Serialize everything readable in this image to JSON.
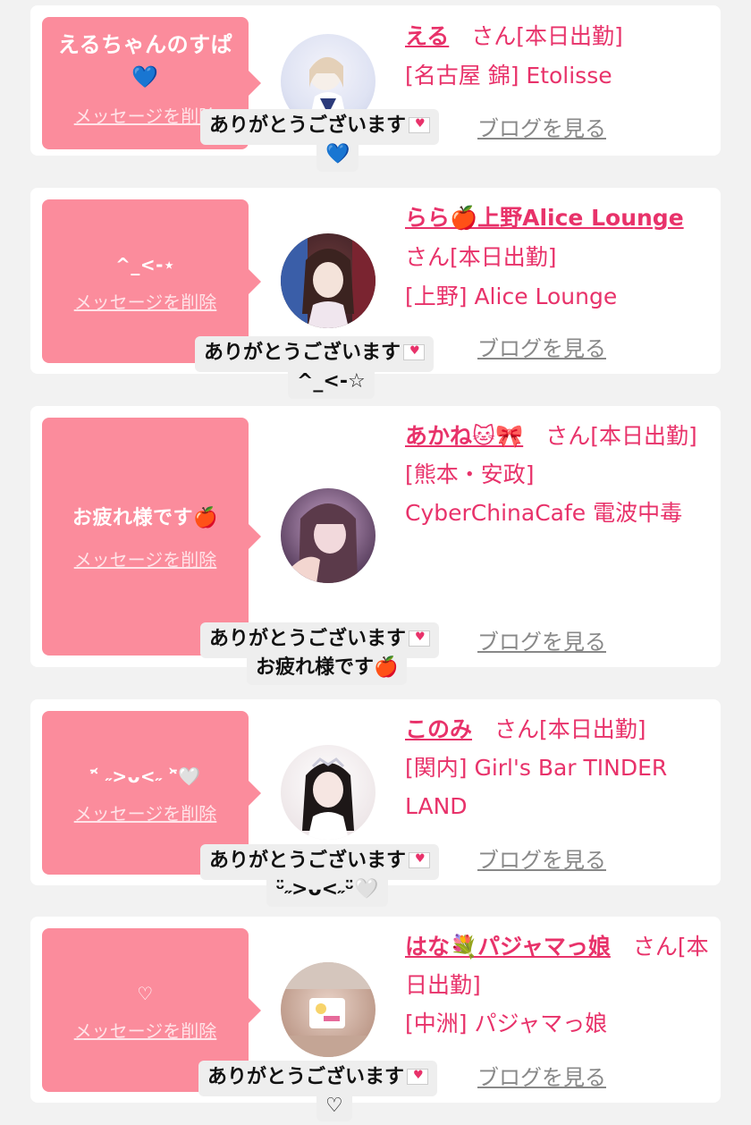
{
  "colors": {
    "accent": "#e8326a",
    "message_box": "#fb8c9c",
    "bubble": "#eeeeee",
    "background": "#f2f2f2"
  },
  "cards": [
    {
      "message": "えるちゃんのすぱ💙",
      "delete_label": "メッセージを削除",
      "name": "える",
      "san_label": "さん",
      "status": "[本日出勤]",
      "location": "[名古屋 錦] Etolisse",
      "blog_label": "ブログを見る",
      "bubble_line1": "ありがとうございます",
      "bubble_line2": "💙",
      "avatar_icon": "avatar-photo"
    },
    {
      "message": "^_<-⋆",
      "delete_label": "メッセージを削除",
      "name": "らら🍎上野Alice Lounge",
      "san_label": "さん",
      "status": "[本日出勤]",
      "location": "[上野] Alice Lounge",
      "blog_label": "ブログを見る",
      "bubble_line1": "ありがとうございます",
      "bubble_line2": "^_<-☆",
      "avatar_icon": "avatar-photo"
    },
    {
      "message": "お疲れ様です🍎",
      "delete_label": "メッセージを削除",
      "name": "あかね🐱🎀",
      "san_label": "さん",
      "status": "[本日出勤]",
      "location": "[熊本・安政] CyberChinaCafe 電波中毒",
      "blog_label": "ブログを見る",
      "bubble_line1": "ありがとうございます",
      "bubble_line2": "お疲れ様です🍎",
      "avatar_icon": "avatar-photo"
    },
    {
      "message": "ᵔ᷄ ˶>ᴗ<˶ ᵔ᷅🤍",
      "delete_label": "メッセージを削除",
      "name": "このみ",
      "san_label": "さん",
      "status": "[本日出勤]",
      "location": "[関内] Girl's Bar TINDER LAND",
      "blog_label": "ブログを見る",
      "bubble_line1": "ありがとうございます",
      "bubble_line2": "ᵕ̈˶>ᴗ<˶ᵕ̈🤍",
      "avatar_icon": "avatar-photo"
    },
    {
      "message": "♡",
      "delete_label": "メッセージを削除",
      "name": "はな💐パジャマっ娘",
      "san_label": "さん",
      "status": "[本日出勤]",
      "location": "[中洲] パジャマっ娘",
      "blog_label": "ブログを見る",
      "bubble_line1": "ありがとうございます",
      "bubble_line2": "♡",
      "avatar_icon": "avatar-photo"
    }
  ]
}
